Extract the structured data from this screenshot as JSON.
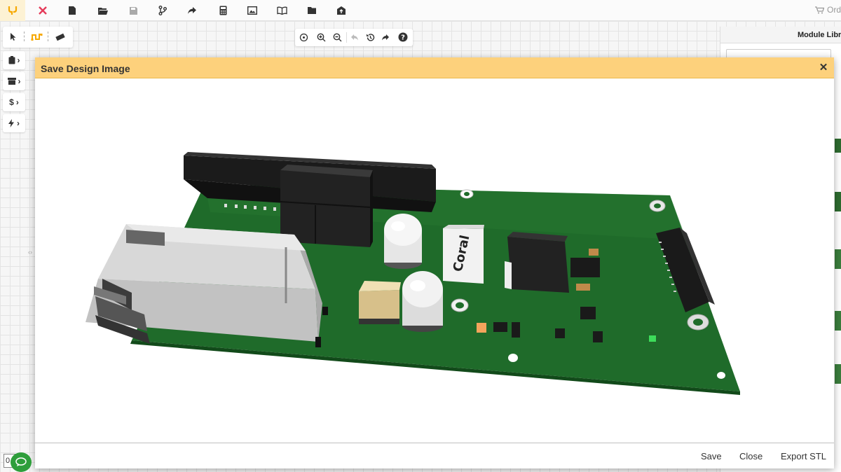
{
  "topbar": {
    "order_label": "Ord"
  },
  "toolbar_icons": [
    "logo-icon",
    "tools-icon",
    "new-file-icon",
    "open-folder-icon",
    "save-icon",
    "branch-icon",
    "share-icon",
    "calculator-icon",
    "image-icon",
    "book-icon",
    "folder-icon",
    "upload-icon"
  ],
  "side_buttons": [
    {
      "icon": "clipboard-icon"
    },
    {
      "icon": "archive-icon"
    },
    {
      "icon": "dollar-icon",
      "label": "$"
    },
    {
      "icon": "lightning-icon"
    }
  ],
  "module_panel": {
    "title": "Module Libra"
  },
  "modal": {
    "title": "Save Design Image",
    "close_symbol": "✕",
    "footer": {
      "save": "Save",
      "close": "Close",
      "export": "Export STL"
    }
  },
  "board": {
    "chip_label": "Coral"
  },
  "bottom": {
    "counter": "0"
  },
  "colors": {
    "header": "#fdd17c",
    "pcb": "#1f6b2a",
    "accent": "#f6a800",
    "chat": "#2e9e3b"
  }
}
